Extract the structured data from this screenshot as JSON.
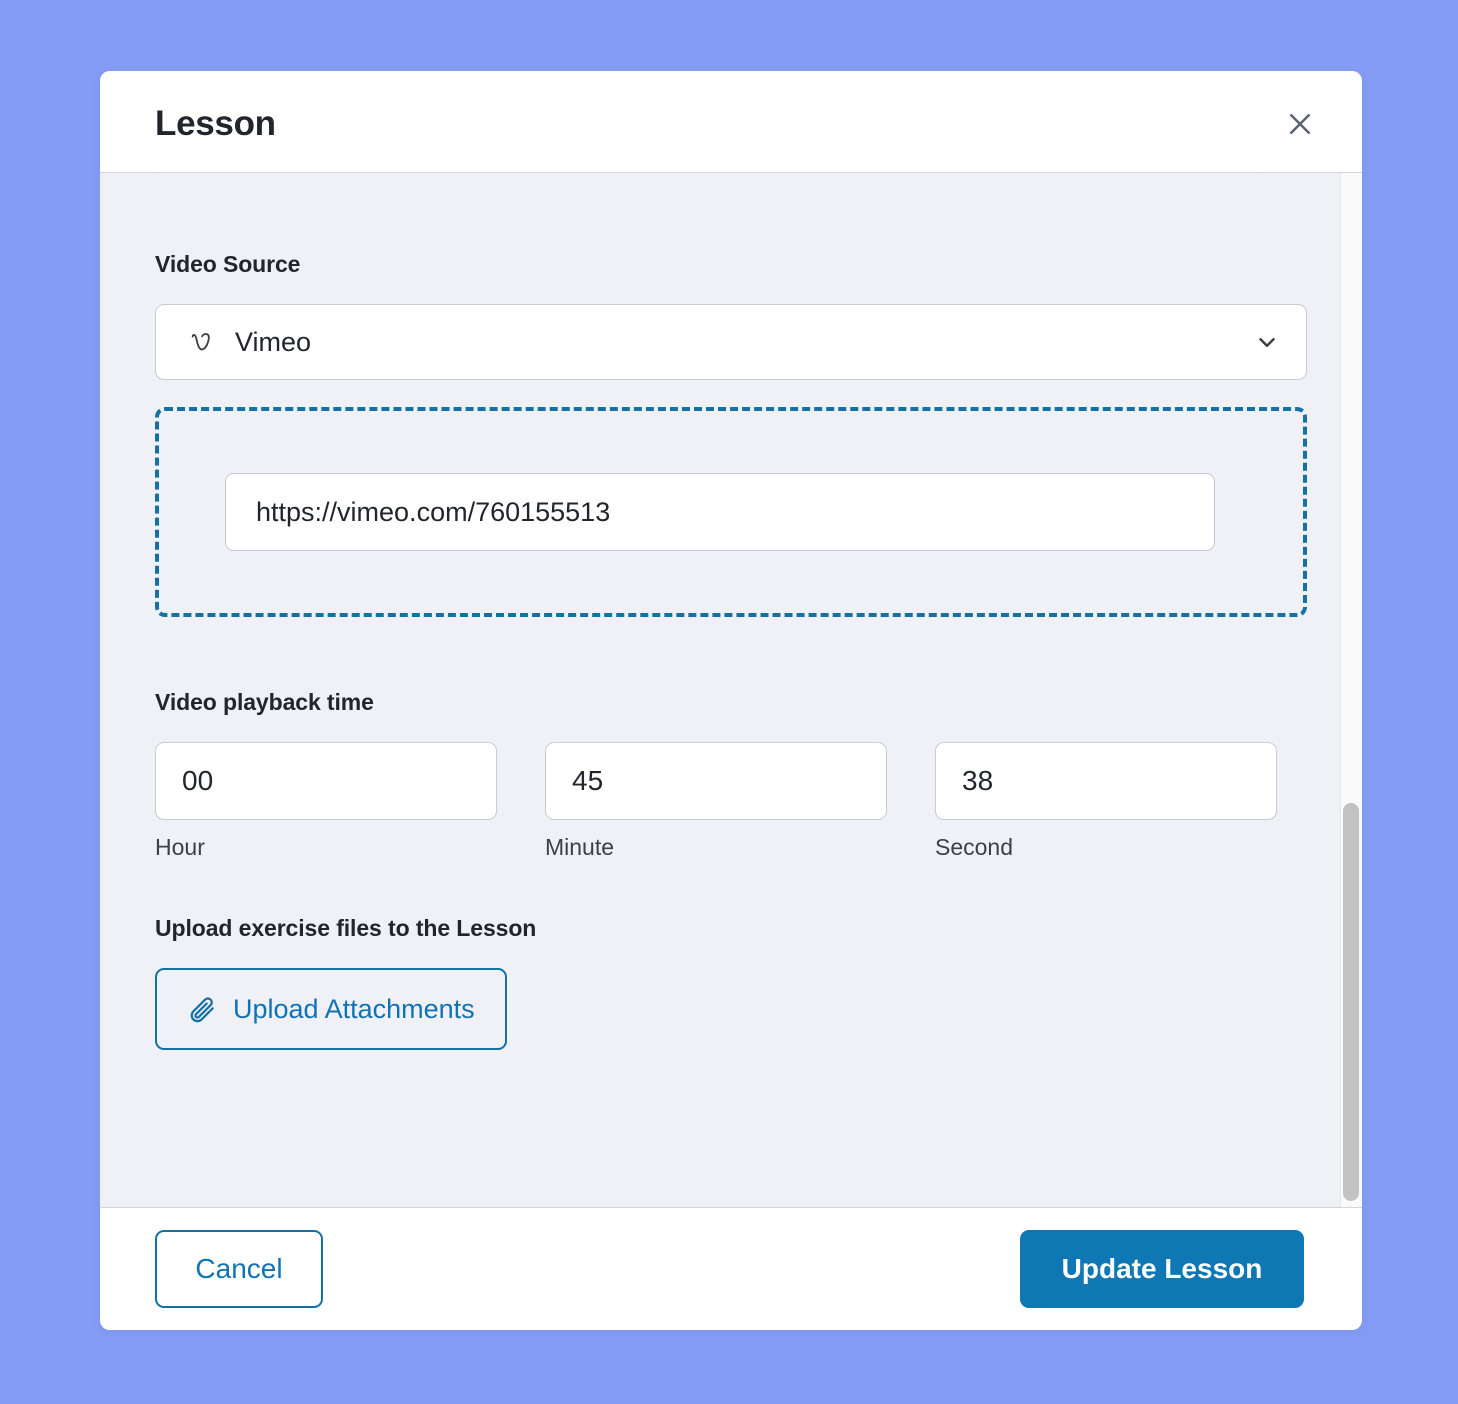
{
  "page": {
    "background_color": "#849cf5"
  },
  "modal": {
    "title": "Lesson",
    "close_icon": "close-icon",
    "body": {
      "video_source": {
        "label": "Video Source",
        "selected_option": "Vimeo",
        "option_icon": "vimeo-icon",
        "chevron_icon": "chevron-down-icon"
      },
      "video_url": {
        "value": "https://vimeo.com/760155513",
        "placeholder": "https://vimeo.com/760155513"
      },
      "playback_time": {
        "label": "Video playback time",
        "fields": [
          {
            "value": "00",
            "caption": "Hour"
          },
          {
            "value": "45",
            "caption": "Minute"
          },
          {
            "value": "38",
            "caption": "Second"
          }
        ]
      },
      "attachments": {
        "label": "Upload exercise files to the Lesson",
        "button_label": "Upload Attachments",
        "button_icon": "paperclip-icon"
      }
    },
    "footer": {
      "cancel_label": "Cancel",
      "update_label": "Update Lesson"
    },
    "colors": {
      "accent": "#1173b4",
      "primary_button": "#0f78b4",
      "dashed_border": "#1471a4",
      "body_background": "#eff1f6"
    }
  }
}
